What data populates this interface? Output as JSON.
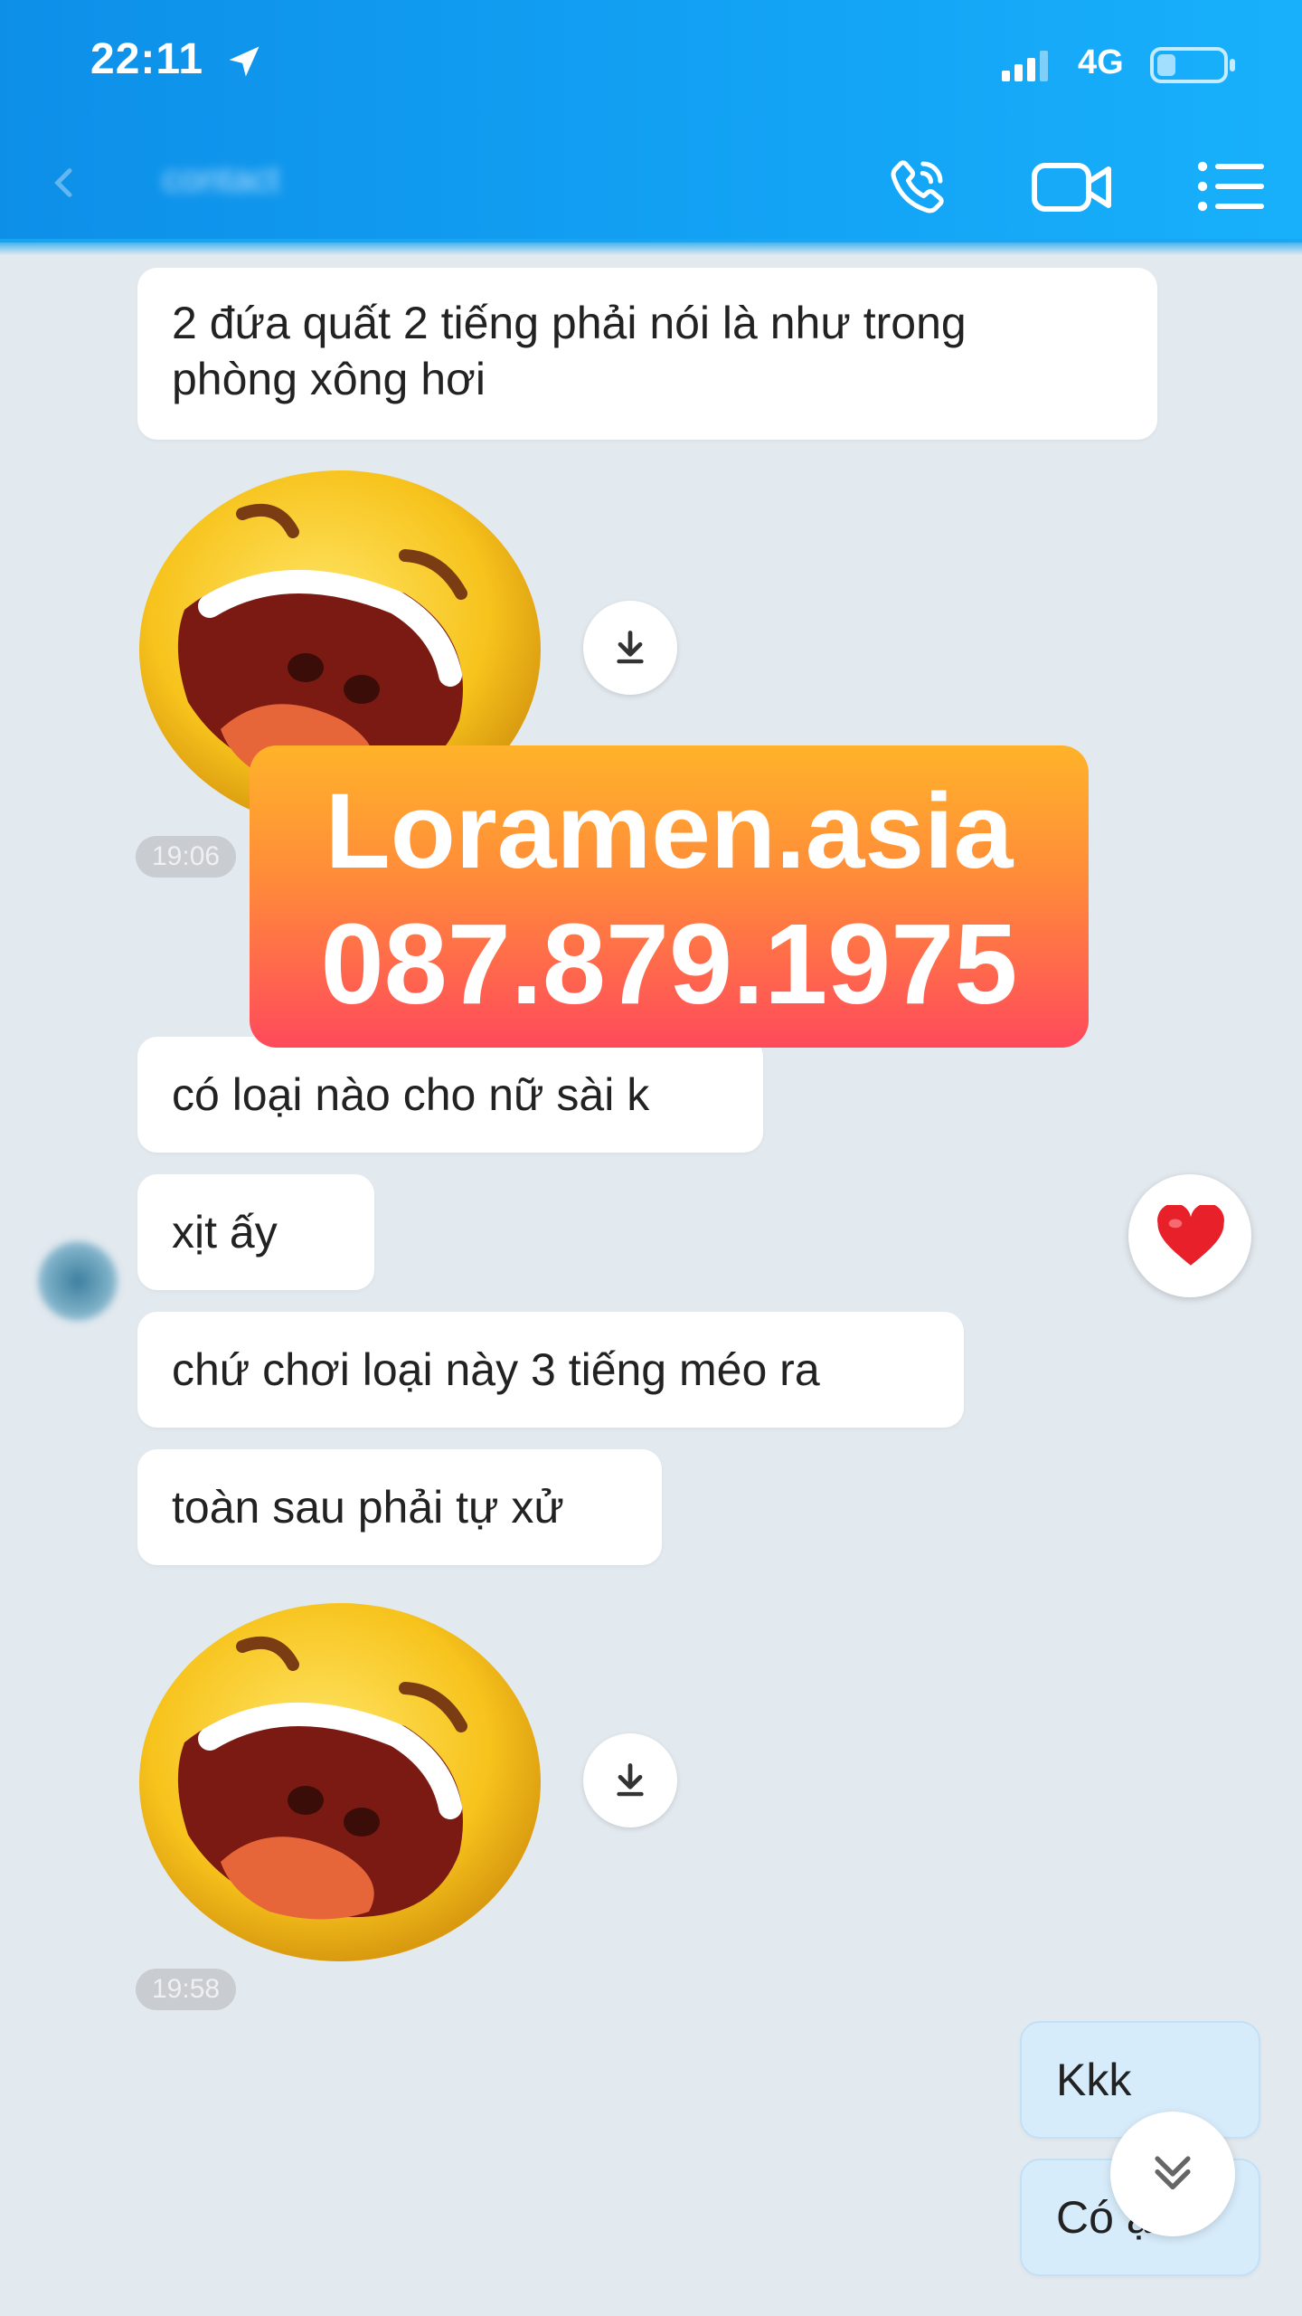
{
  "status_bar": {
    "time": "22:11",
    "network": "4G"
  },
  "header": {
    "contact_name": "contact"
  },
  "messages": {
    "m1_line1": "2 đứa quất 2 tiếng phải nói là như trong",
    "m1_line2": "phòng xông hơi",
    "stamp1": "19:06",
    "m2": "có loại nào cho nữ sài k",
    "m3": "xịt ấy",
    "m4": "chứ chơi loại này 3 tiếng méo ra",
    "m5": "toàn sau phải tự xử",
    "stamp2": "19:58",
    "out1": "Kkk",
    "out2": "Có ạ"
  },
  "watermark": {
    "line1": "Loramen.asia",
    "line2": "087.879.1975"
  },
  "icons": {
    "location": "location-arrow-icon",
    "signal": "signal-icon",
    "battery": "battery-icon",
    "back": "back-arrow-icon",
    "call": "phone-call-icon",
    "video": "video-call-icon",
    "menu": "menu-list-icon",
    "download": "download-icon",
    "reaction": "heart-icon",
    "scroll": "chevron-double-down-icon"
  },
  "colors": {
    "header": "#13a3f5",
    "incoming_bubble": "#ffffff",
    "outgoing_bubble": "#d7ecfb",
    "watermark_top": "#ffb32a",
    "watermark_bottom": "#ff4a5c",
    "heart": "#e8202a"
  }
}
